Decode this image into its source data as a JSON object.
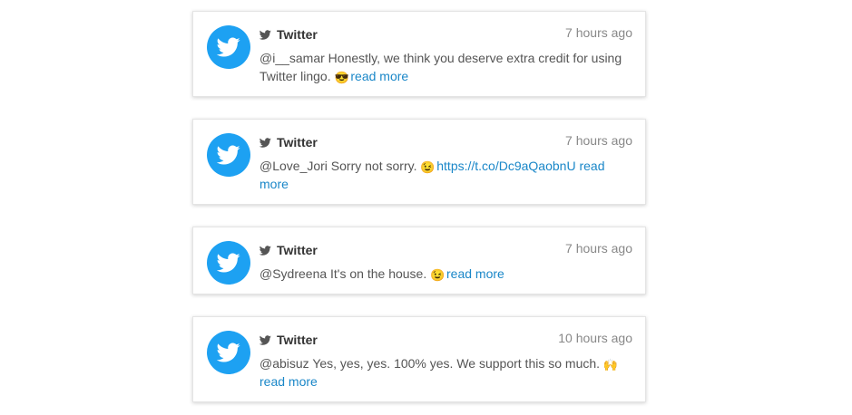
{
  "colors": {
    "twitter_blue": "#1da1f2",
    "link": "#1a87c8",
    "text": "#555555",
    "time": "#888888"
  },
  "tweets": [
    {
      "source": "Twitter",
      "time": "7 hours ago",
      "text": "@i__samar Honestly, we think you deserve extra credit for using Twitter lingo.",
      "emoji": "😎",
      "url": "",
      "read_more": "read more"
    },
    {
      "source": "Twitter",
      "time": "7 hours ago",
      "text": "@Love_Jori Sorry not sorry.",
      "emoji": "😉",
      "url": "https://t.co/Dc9aQaobnU",
      "read_more": "read more"
    },
    {
      "source": "Twitter",
      "time": "7 hours ago",
      "text": "@Sydreena It's on the house.",
      "emoji": "😉",
      "url": "",
      "read_more": "read more"
    },
    {
      "source": "Twitter",
      "time": "10 hours ago",
      "text": "@abisuz Yes, yes, yes. 100% yes. We support this so much.",
      "emoji": "🙌",
      "url": "",
      "read_more": "read more"
    }
  ]
}
